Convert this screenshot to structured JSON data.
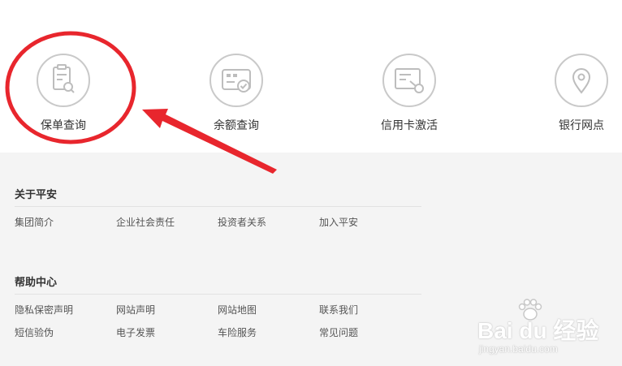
{
  "services": [
    {
      "label": "保单查询",
      "icon": "policy-search-icon"
    },
    {
      "label": "余额查询",
      "icon": "balance-card-icon"
    },
    {
      "label": "信用卡激活",
      "icon": "card-activate-icon"
    },
    {
      "label": "银行网点",
      "icon": "location-pin-icon"
    }
  ],
  "footer": {
    "about": {
      "title": "关于平安",
      "links": [
        "集团简介",
        "企业社会责任",
        "投资者关系",
        "加入平安"
      ]
    },
    "help": {
      "title": "帮助中心",
      "row1": [
        "隐私保密声明",
        "网站声明",
        "网站地图",
        "联系我们"
      ],
      "row2": [
        "短信验伪",
        "电子发票",
        "车险服务",
        "常见问题"
      ]
    }
  },
  "watermark": {
    "brand": "Bai du 经验",
    "url": "jingyan.baidu.com"
  },
  "colors": {
    "annotation": "#e8262d",
    "icon_stroke": "#bdbdbd",
    "footer_bg": "#f4f4f4"
  }
}
